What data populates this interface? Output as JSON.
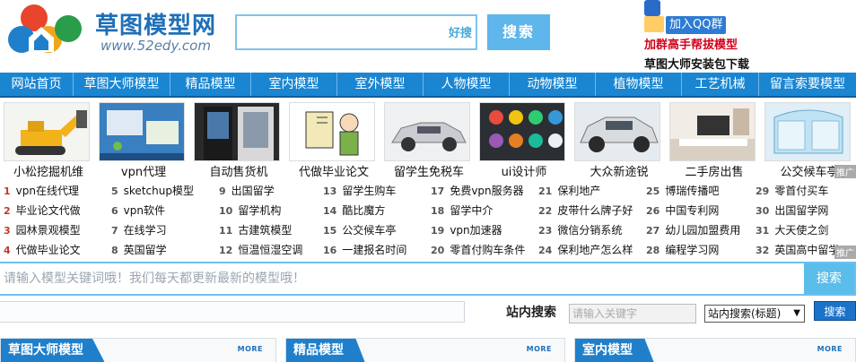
{
  "header": {
    "logo_title": "草图模型网",
    "logo_url": "www.52edy.com",
    "search_badge": "好搜",
    "search_button": "搜索",
    "qq_button": "加入QQ群",
    "qq_tagline": "加群高手帮拔模型",
    "download_link": "草图大师安装包下载"
  },
  "nav": {
    "items": [
      "网站首页",
      "草图大师模型",
      "精品模型",
      "室内模型",
      "室外模型",
      "人物模型",
      "动物模型",
      "植物模型",
      "工艺机械",
      "留言索要模型"
    ]
  },
  "thumbs": {
    "captions": [
      "小松挖掘机维",
      "vpn代理",
      "自动售货机",
      "代做毕业论文",
      "留学生免税车",
      "ui设计师",
      "大众新途锐",
      "二手房出售",
      "公交候车亭"
    ],
    "ad_label": "推广"
  },
  "links": {
    "columns": [
      [
        {
          "n": "1",
          "t": "vpn在线代理"
        },
        {
          "n": "2",
          "t": "毕业论文代做"
        },
        {
          "n": "3",
          "t": "园林景观模型"
        },
        {
          "n": "4",
          "t": "代做毕业论文"
        }
      ],
      [
        {
          "n": "5",
          "t": "sketchup模型"
        },
        {
          "n": "6",
          "t": "vpn软件"
        },
        {
          "n": "7",
          "t": "在线学习"
        },
        {
          "n": "8",
          "t": "英国留学"
        }
      ],
      [
        {
          "n": "9",
          "t": "出国留学"
        },
        {
          "n": "10",
          "t": "留学机构"
        },
        {
          "n": "11",
          "t": "古建筑模型"
        },
        {
          "n": "12",
          "t": "恒温恒湿空调"
        }
      ],
      [
        {
          "n": "13",
          "t": "留学生购车"
        },
        {
          "n": "14",
          "t": "酷比魔方"
        },
        {
          "n": "15",
          "t": "公交候车亭"
        },
        {
          "n": "16",
          "t": "一建报名时间"
        }
      ],
      [
        {
          "n": "17",
          "t": "免费vpn服务器"
        },
        {
          "n": "18",
          "t": "留学中介"
        },
        {
          "n": "19",
          "t": "vpn加速器"
        },
        {
          "n": "20",
          "t": "零首付购车条件"
        }
      ],
      [
        {
          "n": "21",
          "t": "保利地产"
        },
        {
          "n": "22",
          "t": "皮带什么牌子好"
        },
        {
          "n": "23",
          "t": "微信分销系统"
        },
        {
          "n": "24",
          "t": "保利地产怎么样"
        }
      ],
      [
        {
          "n": "25",
          "t": "博瑞传播吧"
        },
        {
          "n": "26",
          "t": "中国专利网"
        },
        {
          "n": "27",
          "t": "幼儿园加盟费用"
        },
        {
          "n": "28",
          "t": "编程学习网"
        }
      ],
      [
        {
          "n": "29",
          "t": "零首付买车"
        },
        {
          "n": "30",
          "t": "出国留学网"
        },
        {
          "n": "31",
          "t": "大天使之剑"
        },
        {
          "n": "32",
          "t": "英国高中留学"
        }
      ]
    ],
    "ad_label": "推广"
  },
  "bigsearch": {
    "placeholder": "请输入模型关键词哦！我们每天都更新最新的模型哦！",
    "button": "搜索"
  },
  "sitesearch": {
    "label": "站内搜索",
    "placeholder": "请输入关键字",
    "select_value": "站内搜索(标题)",
    "button": "搜索"
  },
  "sections": [
    {
      "title": "草图大师模型",
      "more": "MORE"
    },
    {
      "title": "精品模型",
      "more": "MORE"
    },
    {
      "title": "室内模型",
      "more": "MORE"
    }
  ],
  "colors": {
    "nav_bg": "#1a86d2",
    "accent_blue": "#1f6fb8",
    "number_red": "#c0392b",
    "qq_red": "#d0021b"
  }
}
